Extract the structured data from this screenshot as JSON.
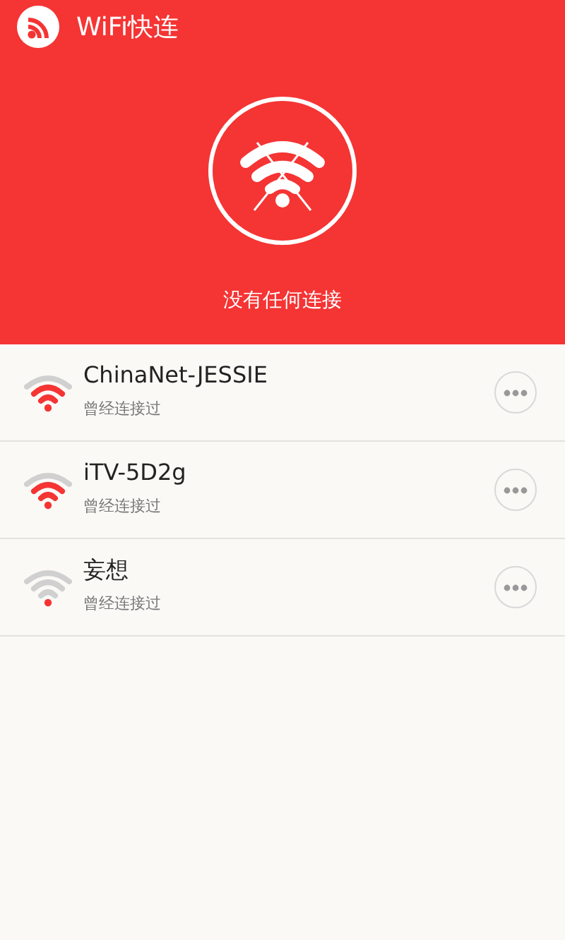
{
  "app_bar": {
    "title": "WiFi快连"
  },
  "status": {
    "text": "没有任何连接"
  },
  "networks": [
    {
      "name": "ChinaNet-JESSIE",
      "subtitle": "曾经连接过",
      "kind": "medium"
    },
    {
      "name": "iTV-5D2g",
      "subtitle": "曾经连接过",
      "kind": "medium"
    },
    {
      "name": "妄想",
      "subtitle": "曾经连接过",
      "kind": "weak"
    }
  ]
}
